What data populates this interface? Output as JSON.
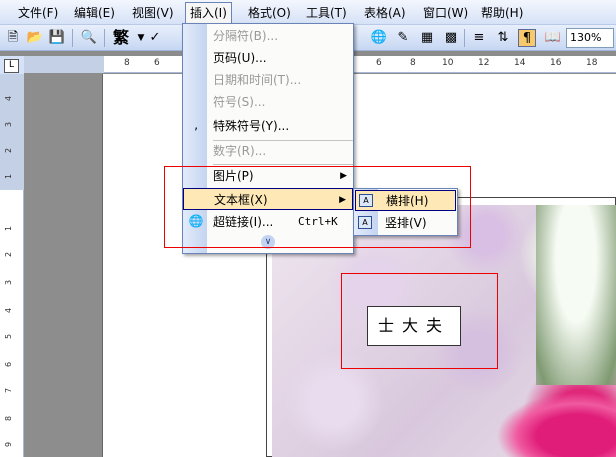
{
  "menubar": {
    "items": [
      {
        "label": "文件(F)"
      },
      {
        "label": "编辑(E)"
      },
      {
        "label": "视图(V)"
      },
      {
        "label": "插入(I)"
      },
      {
        "label": "格式(O)"
      },
      {
        "label": "工具(T)"
      },
      {
        "label": "表格(A)"
      },
      {
        "label": "窗口(W)"
      },
      {
        "label": "帮助(H)"
      }
    ]
  },
  "toolbar": {
    "font_char": "繁",
    "zoom": "130%",
    "icons": [
      "new-doc-icon",
      "open-folder-icon",
      "save-icon",
      "print-preview-icon",
      "traditional-chinese-icon",
      "spellcheck-icon",
      "hyperlink-icon",
      "drawing-icon",
      "table-icon",
      "insert-excel-icon",
      "columns-icon",
      "drawing-toolbar-icon",
      "show-hide-icon",
      "read-mode-icon"
    ]
  },
  "rulers": {
    "horizontal": [
      "8",
      "6",
      "6",
      "8",
      "10",
      "12",
      "14",
      "16",
      "18"
    ],
    "vertical": [
      "4",
      "3",
      "2",
      "1",
      "1",
      "2",
      "3",
      "4",
      "5",
      "6",
      "7",
      "8",
      "9"
    ]
  },
  "insert_menu": {
    "items": [
      {
        "label": "分隔符(B)...",
        "disabled": true
      },
      {
        "label": "页码(U)...",
        "disabled": false
      },
      {
        "label": "日期和时间(T)...",
        "disabled": true
      },
      {
        "label": "符号(S)...",
        "disabled": true
      },
      {
        "label": "特殊符号(Y)...",
        "disabled": false
      },
      {
        "label": "数字(R)...",
        "disabled": true
      },
      {
        "label": "图片(P)",
        "disabled": false
      },
      {
        "label": "文本框(X)",
        "disabled": false
      },
      {
        "label": "超链接(I)...",
        "shortcut": "Ctrl+K",
        "disabled": false
      }
    ]
  },
  "textbox_submenu": {
    "items": [
      {
        "label": "横排(H)"
      },
      {
        "label": "竖排(V)"
      }
    ]
  },
  "document": {
    "textbox_text": "士大夫"
  },
  "colors": {
    "highlight": "#fde8b6",
    "annotation_red": "#e00000",
    "menu_border": "#6b84b8"
  }
}
